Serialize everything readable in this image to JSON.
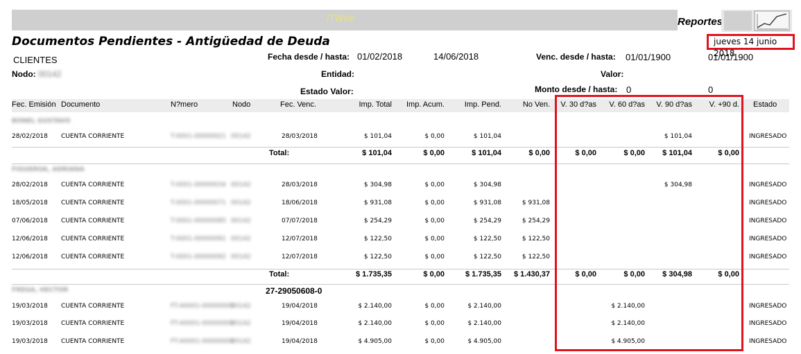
{
  "header": {
    "logo_text": "ITWeb",
    "reportes_label": "Reportes",
    "title": "Documentos Pendientes - Antigüedad de Deuda",
    "date": "jueves 14 junio 2018"
  },
  "filters": {
    "clientes_label": "CLIENTES",
    "nodo_label": "Nodo:",
    "nodo_value": "00142",
    "fecha_label": "Fecha desde / hasta:",
    "fecha_desde": "01/02/2018",
    "fecha_hasta": "14/06/2018",
    "venc_label": "Venc. desde / hasta:",
    "venc_desde": "01/01/1900",
    "venc_hasta": "01/01/1900",
    "entidad_label": "Entidad:",
    "valor_label": "Valor:",
    "estado_valor_label": "Estado Valor:",
    "monto_label": "Monto desde / hasta:",
    "monto_desde": "0",
    "monto_hasta": "0"
  },
  "columns": {
    "fec_emision": "Fec. Emisión",
    "documento": "Documento",
    "numero": "N?mero",
    "nodo": "Nodo",
    "fec_venc": "Fec. Venc.",
    "imp_total": "Imp. Total",
    "imp_acum": "Imp. Acum.",
    "imp_pend": "Imp. Pend.",
    "no_ven": "No Ven.",
    "v30": "V. 30 d?as",
    "v60": "V. 60 d?as",
    "v90": "V. 90 d?as",
    "v90plus": "V. +90 d.",
    "estado": "Estado"
  },
  "groups": [
    {
      "client": "BONEL GUSTAVO",
      "rows": [
        {
          "fec": "28/02/2018",
          "doc": "CUENTA CORRIENTE",
          "num": "T-0001-00000021",
          "nodo": "00142",
          "venc": "28/03/2018",
          "total": "$ 101,04",
          "acum": "$ 0,00",
          "pend": "$ 101,04",
          "nov": "",
          "v30": "",
          "v60": "",
          "v90": "$ 101,04",
          "v90p": "",
          "estado": "INGRESADO"
        }
      ],
      "totals": {
        "label": "Total:",
        "total": "$ 101,04",
        "acum": "$ 0,00",
        "pend": "$ 101,04",
        "nov": "$ 0,00",
        "v30": "$ 0,00",
        "v60": "$ 0,00",
        "v90": "$ 101,04",
        "v90p": "$ 0,00"
      }
    },
    {
      "client": "FIGUEROA, ADRIANA",
      "rows": [
        {
          "fec": "28/02/2018",
          "doc": "CUENTA CORRIENTE",
          "num": "T-0001-00000034",
          "nodo": "00142",
          "venc": "28/03/2018",
          "total": "$ 304,98",
          "acum": "$ 0,00",
          "pend": "$ 304,98",
          "nov": "",
          "v30": "",
          "v60": "",
          "v90": "$ 304,98",
          "v90p": "",
          "estado": "INGRESADO"
        },
        {
          "fec": "18/05/2018",
          "doc": "CUENTA CORRIENTE",
          "num": "T-0001-00000071",
          "nodo": "00142",
          "venc": "18/06/2018",
          "total": "$ 931,08",
          "acum": "$ 0,00",
          "pend": "$ 931,08",
          "nov": "$ 931,08",
          "v30": "",
          "v60": "",
          "v90": "",
          "v90p": "",
          "estado": "INGRESADO"
        },
        {
          "fec": "07/06/2018",
          "doc": "CUENTA CORRIENTE",
          "num": "T-0001-00000085",
          "nodo": "00142",
          "venc": "07/07/2018",
          "total": "$ 254,29",
          "acum": "$ 0,00",
          "pend": "$ 254,29",
          "nov": "$ 254,29",
          "v30": "",
          "v60": "",
          "v90": "",
          "v90p": "",
          "estado": "INGRESADO"
        },
        {
          "fec": "12/06/2018",
          "doc": "CUENTA CORRIENTE",
          "num": "T-0001-00000091",
          "nodo": "00142",
          "venc": "12/07/2018",
          "total": "$ 122,50",
          "acum": "$ 0,00",
          "pend": "$ 122,50",
          "nov": "$ 122,50",
          "v30": "",
          "v60": "",
          "v90": "",
          "v90p": "",
          "estado": "INGRESADO"
        },
        {
          "fec": "12/06/2018",
          "doc": "CUENTA CORRIENTE",
          "num": "T-0001-00000092",
          "nodo": "00142",
          "venc": "12/07/2018",
          "total": "$ 122,50",
          "acum": "$ 0,00",
          "pend": "$ 122,50",
          "nov": "$ 122,50",
          "v30": "",
          "v60": "",
          "v90": "",
          "v90p": "",
          "estado": "INGRESADO"
        }
      ],
      "totals": {
        "label": "Total:",
        "total": "$ 1.735,35",
        "acum": "$ 0,00",
        "pend": "$ 1.735,35",
        "nov": "$ 1.430,37",
        "v30": "$ 0,00",
        "v60": "$ 0,00",
        "v90": "$ 304,98",
        "v90p": "$ 0,00"
      }
    },
    {
      "client": "FREGA, HECTOR",
      "cuit": "27-29050608-0",
      "rows": [
        {
          "fec": "19/03/2018",
          "doc": "CUENTA CORRIENTE",
          "num": "FT-A0001-00000000",
          "nodo": "00142",
          "venc": "19/04/2018",
          "total": "$ 2.140,00",
          "acum": "$ 0,00",
          "pend": "$ 2.140,00",
          "nov": "",
          "v30": "",
          "v60": "$ 2.140,00",
          "v90": "",
          "v90p": "",
          "estado": "INGRESADO"
        },
        {
          "fec": "19/03/2018",
          "doc": "CUENTA CORRIENTE",
          "num": "FT-A0001-00000000",
          "nodo": "00142",
          "venc": "19/04/2018",
          "total": "$ 2.140,00",
          "acum": "$ 0,00",
          "pend": "$ 2.140,00",
          "nov": "",
          "v30": "",
          "v60": "$ 2.140,00",
          "v90": "",
          "v90p": "",
          "estado": "INGRESADO"
        },
        {
          "fec": "19/03/2018",
          "doc": "CUENTA CORRIENTE",
          "num": "FT-A0001-00000000",
          "nodo": "00142",
          "venc": "19/04/2018",
          "total": "$ 4.905,00",
          "acum": "$ 0,00",
          "pend": "$ 4.905,00",
          "nov": "",
          "v30": "",
          "v60": "$ 4.905,00",
          "v90": "",
          "v90p": "",
          "estado": "INGRESADO"
        }
      ]
    }
  ],
  "colors": {
    "highlight": "#e0121f",
    "header_bar": "#cfcfcf"
  }
}
